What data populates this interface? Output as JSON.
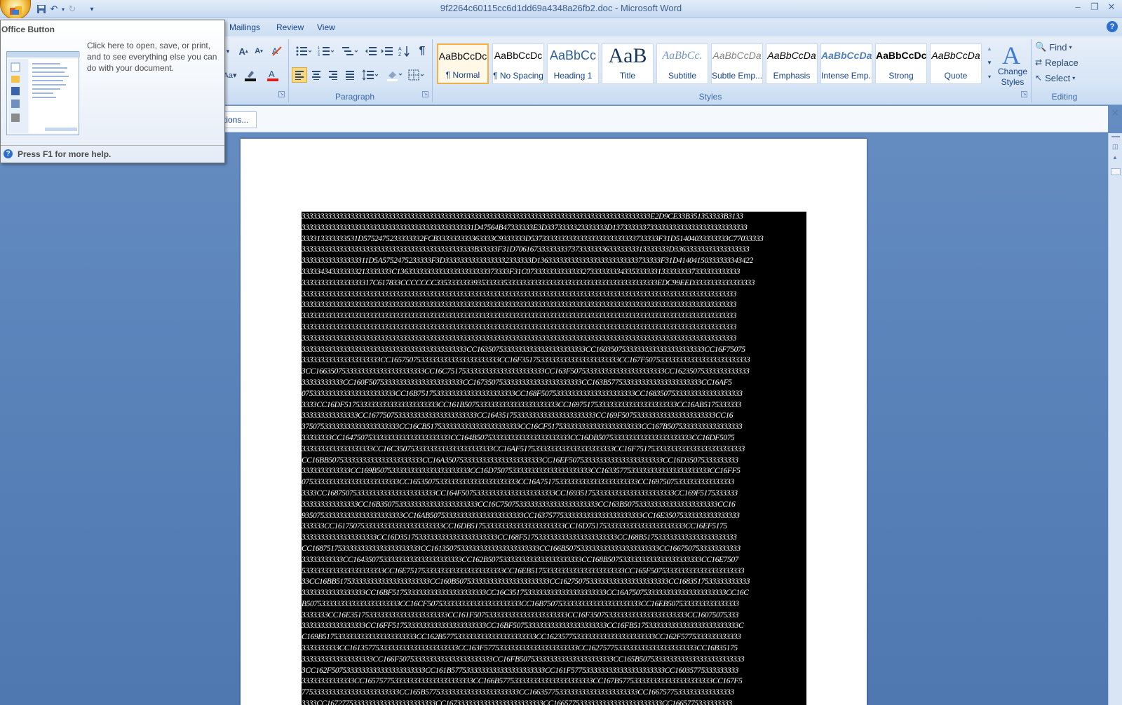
{
  "window": {
    "title_doc": "9f2264c60115cc6d1dd69a4348a26fb2.doc",
    "title_sep": " - ",
    "title_app": "Microsoft Word"
  },
  "tabs": [
    "Mailings",
    "Review",
    "View"
  ],
  "ribbon": {
    "groups": {
      "paragraph": "Paragraph",
      "styles": "Styles",
      "editing": "Editing"
    },
    "styles": [
      {
        "sample": "AaBbCcDc",
        "name": "¶ Normal",
        "active": true
      },
      {
        "sample": "AaBbCcDc",
        "name": "¶ No Spacing",
        "active": false
      },
      {
        "sample": "AaBbCc",
        "name": "Heading 1",
        "active": false
      },
      {
        "sample": "AaB",
        "name": "Title",
        "active": false
      },
      {
        "sample": "AaBbCc.",
        "name": "Subtitle",
        "active": false
      },
      {
        "sample": "AaBbCcDa",
        "name": "Subtle Emp...",
        "active": false
      },
      {
        "sample": "AaBbCcDa",
        "name": "Emphasis",
        "active": false
      },
      {
        "sample": "AaBbCcDa",
        "name": "Intense Emp...",
        "active": false
      },
      {
        "sample": "AaBbCcDc",
        "name": "Strong",
        "active": false
      },
      {
        "sample": "AaBbCcDa",
        "name": "Quote",
        "active": false
      }
    ],
    "change_styles": "Change Styles",
    "find": "Find",
    "replace": "Replace",
    "select": "Select"
  },
  "message_bar": {
    "options_button": "tions..."
  },
  "tooltip": {
    "title": "Office Button",
    "text": "Click here to open, save, or print, and to see everything else you can do with your document.",
    "help": "Press F1 for more help."
  },
  "document": {
    "lines": [
      "333333333333333333333333333333333333333333333333333333333333333333333333333333333333333333333E2D9CE33B351353333B3133",
      "3333333333333333333333333333333333333333333331D47564B47333333E3D3373333323333333D137333333733333333333333333333333333",
      "333313333333531D5752475233333332FCB333333333363333C9333333D5373333333333333333333333333733333F31D51404033333333C77033333",
      "3333333333333333333333333333333333333333333333B33333F31D70616733333333737333333363333333313333333D33633333333333333333",
      "333333333333333311D5A5752475233333F3D33333333333333332333333D136333333333333333333333333733333F31D41404150333333343422",
      "333334343333333213333333C136333333333333333333333373333F31C073333333333333273333333343353333331333333337333333333333",
      "3333333333333333317C617833CCCCCCC33533333339353333353333333333333333333333333333333333333333EDC99EED3333333333333333",
      "33333333333333333333333333333333333333333333333333333333333333333333333333333333333333333333333333333333333333333333",
      "33333333333333333333333333333333333333333333333333333333333333333333333333333333333333333333333333333333333333333333",
      "33333333333333333333333333333333333333333333333333333333333333333333333333333333333333333333333333333333333333333333",
      "33333333333333333333333333333333333333333333333333333333333333333333333333333333333333333333333333333333333333333333",
      "33333333333333333333333333333333333333333333333333333333333333333333333333333333333333333333333333333333333333333333",
      "33333333333333333333333333333333333333333333CC16350753333333333333333333333CC16035075333333333333333333333CC16F75075",
      "333333333333333333333CC16575075333333333333333333333CC16F35175333333333333333333333CC167F5075333333333333333333333333",
      "3CC16635075333333333333333333333CC16C75175333333333333333333333CC163F5075333333333333333333333CC16235075333333333333",
      "33333333333CC160F5075333333333333333333333CC16735075333333333333333333333CC163B5775333333333333333333333CC16AF5",
      "0753333333333333333333333CC16B75175333333333333333333333CC168F5075333333333333333333333CC16835075333333333333333333",
      "3333CC16DF5175333333333333333333333CC161B5075333333333333333333333CC16975175333333333333333333333CC16AB5175333333",
      "333333333333333CC16775075333333333333333333333CC16435175333333333333333333333CC169F5075333333333333333333333CC16",
      "37507533333333333333333333CC16CB5175333333333333333333333CC16CF5175333333333333333333333CC167B50753333333333333333",
      "33333333CC16475075333333333333333333333CC164B5075333333333333333333333CC16DB5075333333333333333333333CC16DF5075",
      "3333333333333333333CC16C35075333333333333333333333CC16AF5175333333333333333333333CC16F75175333333333333333333333333",
      "CC16BB5075333333333333333333333CC16A35075333333333333333333333CC16EF5075333333333333333333333CC16D35075333333333",
      "3333333333333CC169B5075333333333333333333333CC16D75075333333333333333333333CC16335775333333333333333333333CC16FF5",
      "07533333333333333333333333CC16535075333333333333333333333CC16A75175333333333333333333333CC16975075333333333333333",
      "3333CC16875075333333333333333333333CC164F5075333333333333333333333CC16935175333333333333333333333CC169F5175333333",
      "333333333333333CC16B35075333333333333333333333CC16C75075333333333333333333333CC163B5075333333333333333333333CC16",
      "935075333333333333333333333CC16AB5075333333333333333333333CC16375775333333333333333333333CC16E35075333333333333333",
      "333333CC16175075333333333333333333333CC16DB5175333333333333333333333CC16D75175333333333333333333333CC16EF5175",
      "33333333333333333333CC16D35175333333333333333333333CC168F5175333333333333333333333CC168B5175333333333333333333333",
      "CC16875175333333333333333333333CC16135075333333333333333333333CC166B5075333333333333333333333CC1667507533333333333",
      "33333333333CC16435075333333333333333333333CC162B5075333333333333333333333CC168B5075333333333333333333333CC16E7507",
      "5333333333333333333333CC16E75175333333333333333333333CC16EB5175333333333333333333333CC165F5075333333333333333333333",
      "33CC16BB5175333333333333333333333CC160B5075333333333333333333333CC16275075333333333333333333333CC1683517533333333333",
      "33333333333333333CC16BF5175333333333333333333333CC16C35175333333333333333333333CC16A75075333333333333333333333CC16C",
      "B5075333333333333333333333CC16CF5075333333333333333333333CC16B75075333333333333333333333CC16EB5075333333333333333",
      "3333333CC16E35175333333333333333333333CC161F5075333333333333333333333CC16F35075333333333333333333333CC16075075333",
      "33333333333333333CC16FF5175333333333333333333333CC16BF5075333333333333333333333CC16FB5175333333333333333333333333C",
      "C169B5175333333333333333333333CC162B5775333333333333333333333CC16235775333333333333333333333CC162F5775333333333333",
      "3333333333CC16135775333333333333333333333CC163F5775333333333333333333333CC16275775333333333333333333333CC16B35175",
      "3333333333333333333CC166F5075333333333333333333333CC16FB5075333333333333333333333CC165B5075333333333333333333333333",
      "3CC162F5075333333333333333333333CC161B5775333333333333333333333CC161F5775333333333333333333333CC16035775333333333",
      "33333333333333CC16575775333333333333333333333CC166B5775333333333333333333333CC167B5775333333333333333333333CC167F5",
      "77533333333333333333333333CC165B5775333333333333333333333CC16635775333333333333333333333CC16675775333333333333333",
      "3333CC16727753333333333333333333333CC16733333333333333333333333CC16657753333333333333333333333CC1665775333333333"
    ]
  }
}
